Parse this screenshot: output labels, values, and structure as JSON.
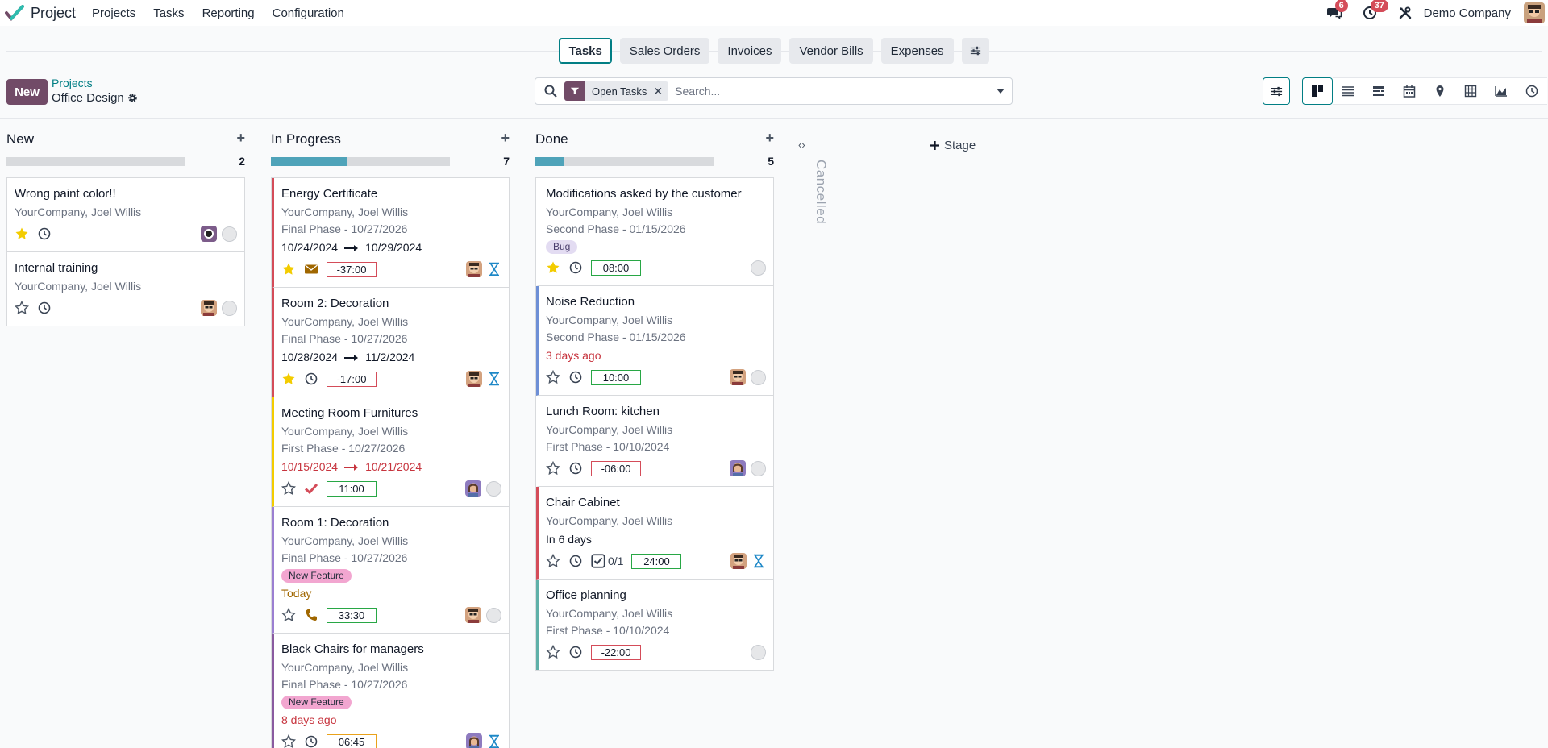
{
  "navbar": {
    "app_name": "Project",
    "menu": [
      "Projects",
      "Tasks",
      "Reporting",
      "Configuration"
    ],
    "messages_badge": "6",
    "activities_badge": "37",
    "company": "Demo Company"
  },
  "tabs": [
    "Tasks",
    "Sales Orders",
    "Invoices",
    "Vendor Bills",
    "Expenses"
  ],
  "active_tab": "Tasks",
  "control": {
    "new_label": "New",
    "breadcrumb_parent": "Projects",
    "breadcrumb_current": "Office Design",
    "facet_label": "Open Tasks",
    "search_placeholder": "Search..."
  },
  "colors": {
    "brand": "#714b67",
    "accent": "#017e84",
    "danger": "#d44c59",
    "success": "#28a745",
    "warning": "#e9a21b",
    "progress": "#4fa3b9"
  },
  "columns": [
    {
      "title": "New",
      "count": "2",
      "progress": 0,
      "cards": [
        {
          "title": "Wrong paint color!!",
          "sub": "YourCompany, Joel Willis",
          "starred": true,
          "activity": "clock",
          "avatar": "dark"
        },
        {
          "title": "Internal training",
          "sub": "YourCompany, Joel Willis",
          "starred": false,
          "activity": "clock",
          "avatar": "man"
        }
      ]
    },
    {
      "title": "In Progress",
      "count": "7",
      "progress": 0.43,
      "cards": [
        {
          "title": "Energy Certificate",
          "sub": "YourCompany, Joel Willis",
          "phase": "Final Phase - 10/27/2026",
          "dates": [
            "10/24/2024",
            "10/29/2024"
          ],
          "starred": true,
          "activity": "envelope",
          "hours": "-37:00",
          "hours_style": "red",
          "avatar": "man",
          "state": "hourglass",
          "border": "#d44c59"
        },
        {
          "title": "Room 2: Decoration",
          "sub": "YourCompany, Joel Willis",
          "phase": "Final Phase - 10/27/2026",
          "dates": [
            "10/28/2024",
            "11/2/2024"
          ],
          "starred": true,
          "activity": "clock",
          "hours": "-17:00",
          "hours_style": "red",
          "avatar": "man",
          "state": "hourglass",
          "border": "#d44c59"
        },
        {
          "title": "Meeting Room Furnitures",
          "sub": "YourCompany, Joel Willis",
          "phase": "First Phase - 10/27/2026",
          "dates": [
            "10/15/2024",
            "10/21/2024"
          ],
          "dates_red": true,
          "starred": false,
          "activity": "check",
          "hours": "11:00",
          "hours_style": "green",
          "avatar": "woman",
          "state": "circle",
          "border": "#f3cc00"
        },
        {
          "title": "Room 1: Decoration",
          "sub": "YourCompany, Joel Willis",
          "phase": "Final Phase - 10/27/2026",
          "tag": "New Feature",
          "deadline": "Today",
          "deadline_style": "amber",
          "starred": false,
          "activity": "phone",
          "hours": "33:30",
          "hours_style": "green",
          "avatar": "man",
          "state": "circle",
          "border": "#9b7fd1"
        },
        {
          "title": "Black Chairs for managers",
          "sub": "YourCompany, Joel Willis",
          "phase": "Final Phase - 10/27/2026",
          "tag": "New Feature",
          "deadline": "8 days ago",
          "deadline_style": "red",
          "starred": false,
          "activity": "clock",
          "hours": "06:45",
          "hours_style": "amber",
          "avatar": "woman",
          "state": "hourglass",
          "border": "#8a5ba0"
        }
      ]
    },
    {
      "title": "Done",
      "count": "5",
      "progress": 0.16,
      "cards": [
        {
          "title": "Modifications asked by the customer",
          "sub": "YourCompany, Joel Willis",
          "phase": "Second Phase - 01/15/2026",
          "tag_lavender": "Bug",
          "starred": true,
          "activity": "clock",
          "hours": "08:00",
          "hours_style": "green",
          "state": "circle"
        },
        {
          "title": "Noise Reduction",
          "sub": "YourCompany, Joel Willis",
          "phase": "Second Phase - 01/15/2026",
          "deadline": "3 days ago",
          "deadline_style": "red",
          "starred": false,
          "activity": "clock",
          "hours": "10:00",
          "hours_style": "green",
          "avatar": "man",
          "state": "circle",
          "border": "#6e8fd6"
        },
        {
          "title": "Lunch Room: kitchen",
          "sub": "YourCompany, Joel Willis",
          "phase": "First Phase - 10/10/2024",
          "starred": false,
          "activity": "clock",
          "hours": "-06:00",
          "hours_style": "red",
          "avatar": "woman",
          "state": "circle"
        },
        {
          "title": "Chair Cabinet",
          "sub": "YourCompany, Joel Willis",
          "deadline": "In 6 days",
          "deadline_style": "plain",
          "starred": false,
          "activity": "clock",
          "subtasks": "0/1",
          "hours": "24:00",
          "hours_style": "green",
          "avatar": "man",
          "state": "hourglass",
          "border": "#d44c59"
        },
        {
          "title": "Office planning",
          "sub": "YourCompany, Joel Willis",
          "phase": "First Phase - 10/10/2024",
          "starred": false,
          "activity": "clock",
          "hours": "-22:00",
          "hours_style": "red",
          "state": "circle",
          "border": "#5fb0a8"
        }
      ]
    }
  ],
  "folded_column": "Cancelled",
  "add_stage": "Stage"
}
